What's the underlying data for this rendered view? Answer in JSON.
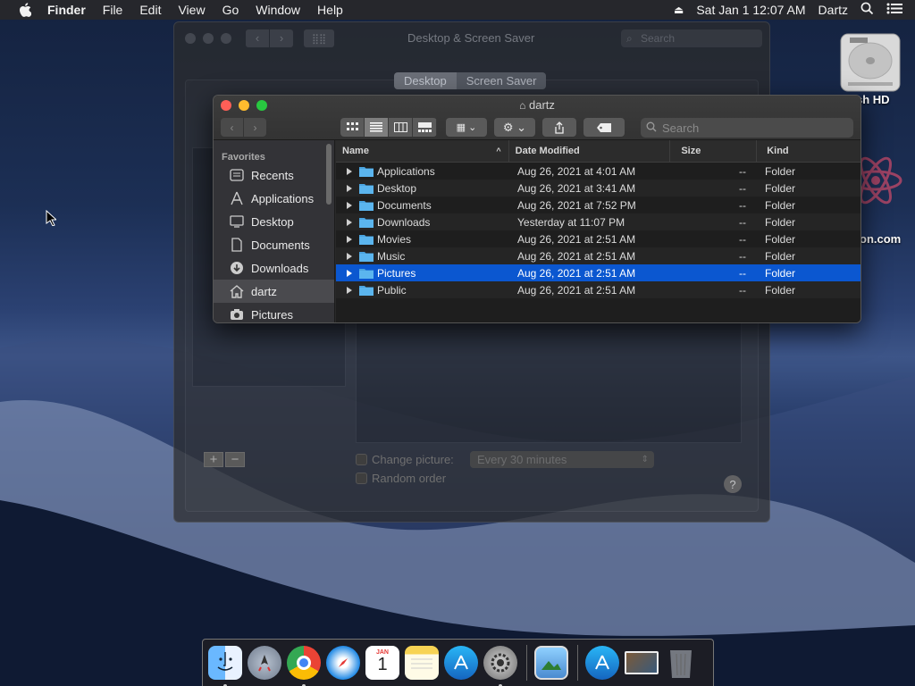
{
  "menubar": {
    "app_name": "Finder",
    "items": [
      "File",
      "Edit",
      "View",
      "Go",
      "Window",
      "Help"
    ],
    "clock": "Sat Jan 1  12:07 AM",
    "user": "Dartz"
  },
  "desktop": {
    "icons": [
      {
        "label": "sh HD",
        "icon": "hard-drive-icon"
      },
      {
        "label": "on.com",
        "icon": "atom-icon"
      }
    ]
  },
  "preferences": {
    "title": "Desktop & Screen Saver",
    "search_placeholder": "Search",
    "tabs": [
      "Desktop",
      "Screen Saver"
    ],
    "selected_tab": "Desktop",
    "change_picture_label": "Change picture:",
    "interval": "Every 30 minutes",
    "random_order_label": "Random order",
    "add": "+",
    "remove": "−",
    "help": "?"
  },
  "finder": {
    "title": "dartz",
    "search_placeholder": "Search",
    "sidebar": {
      "header": "Favorites",
      "items": [
        {
          "label": "Recents",
          "icon": "recents-icon"
        },
        {
          "label": "Applications",
          "icon": "applications-icon"
        },
        {
          "label": "Desktop",
          "icon": "desktop-icon"
        },
        {
          "label": "Documents",
          "icon": "documents-icon"
        },
        {
          "label": "Downloads",
          "icon": "downloads-icon"
        },
        {
          "label": "dartz",
          "icon": "home-icon"
        },
        {
          "label": "Pictures",
          "icon": "camera-icon"
        }
      ]
    },
    "columns": [
      "Name",
      "Date Modified",
      "Size",
      "Kind"
    ],
    "rows": [
      {
        "name": "Applications",
        "date": "Aug 26, 2021 at 4:01 AM",
        "size": "--",
        "kind": "Folder"
      },
      {
        "name": "Desktop",
        "date": "Aug 26, 2021 at 3:41 AM",
        "size": "--",
        "kind": "Folder"
      },
      {
        "name": "Documents",
        "date": "Aug 26, 2021 at 7:52 PM",
        "size": "--",
        "kind": "Folder"
      },
      {
        "name": "Downloads",
        "date": "Yesterday at 11:07 PM",
        "size": "--",
        "kind": "Folder"
      },
      {
        "name": "Movies",
        "date": "Aug 26, 2021 at 2:51 AM",
        "size": "--",
        "kind": "Folder"
      },
      {
        "name": "Music",
        "date": "Aug 26, 2021 at 2:51 AM",
        "size": "--",
        "kind": "Folder"
      },
      {
        "name": "Pictures",
        "date": "Aug 26, 2021 at 2:51 AM",
        "size": "--",
        "kind": "Folder"
      },
      {
        "name": "Public",
        "date": "Aug 26, 2021 at 2:51 AM",
        "size": "--",
        "kind": "Folder"
      }
    ]
  },
  "dock": {
    "items": [
      "finder-icon",
      "launchpad-icon",
      "chrome-icon",
      "safari-icon",
      "calendar-icon",
      "notes-icon",
      "app-store-icon",
      "system-preferences-icon",
      "preview-icon",
      "app-store-folder-icon",
      "photo-stack-icon",
      "trash-icon"
    ],
    "calendar_month": "JAN",
    "calendar_day": "1"
  },
  "colors": {
    "selection": "#0b57d0",
    "close": "#ff5f57",
    "minimize": "#febc2e",
    "zoom": "#28c840"
  }
}
